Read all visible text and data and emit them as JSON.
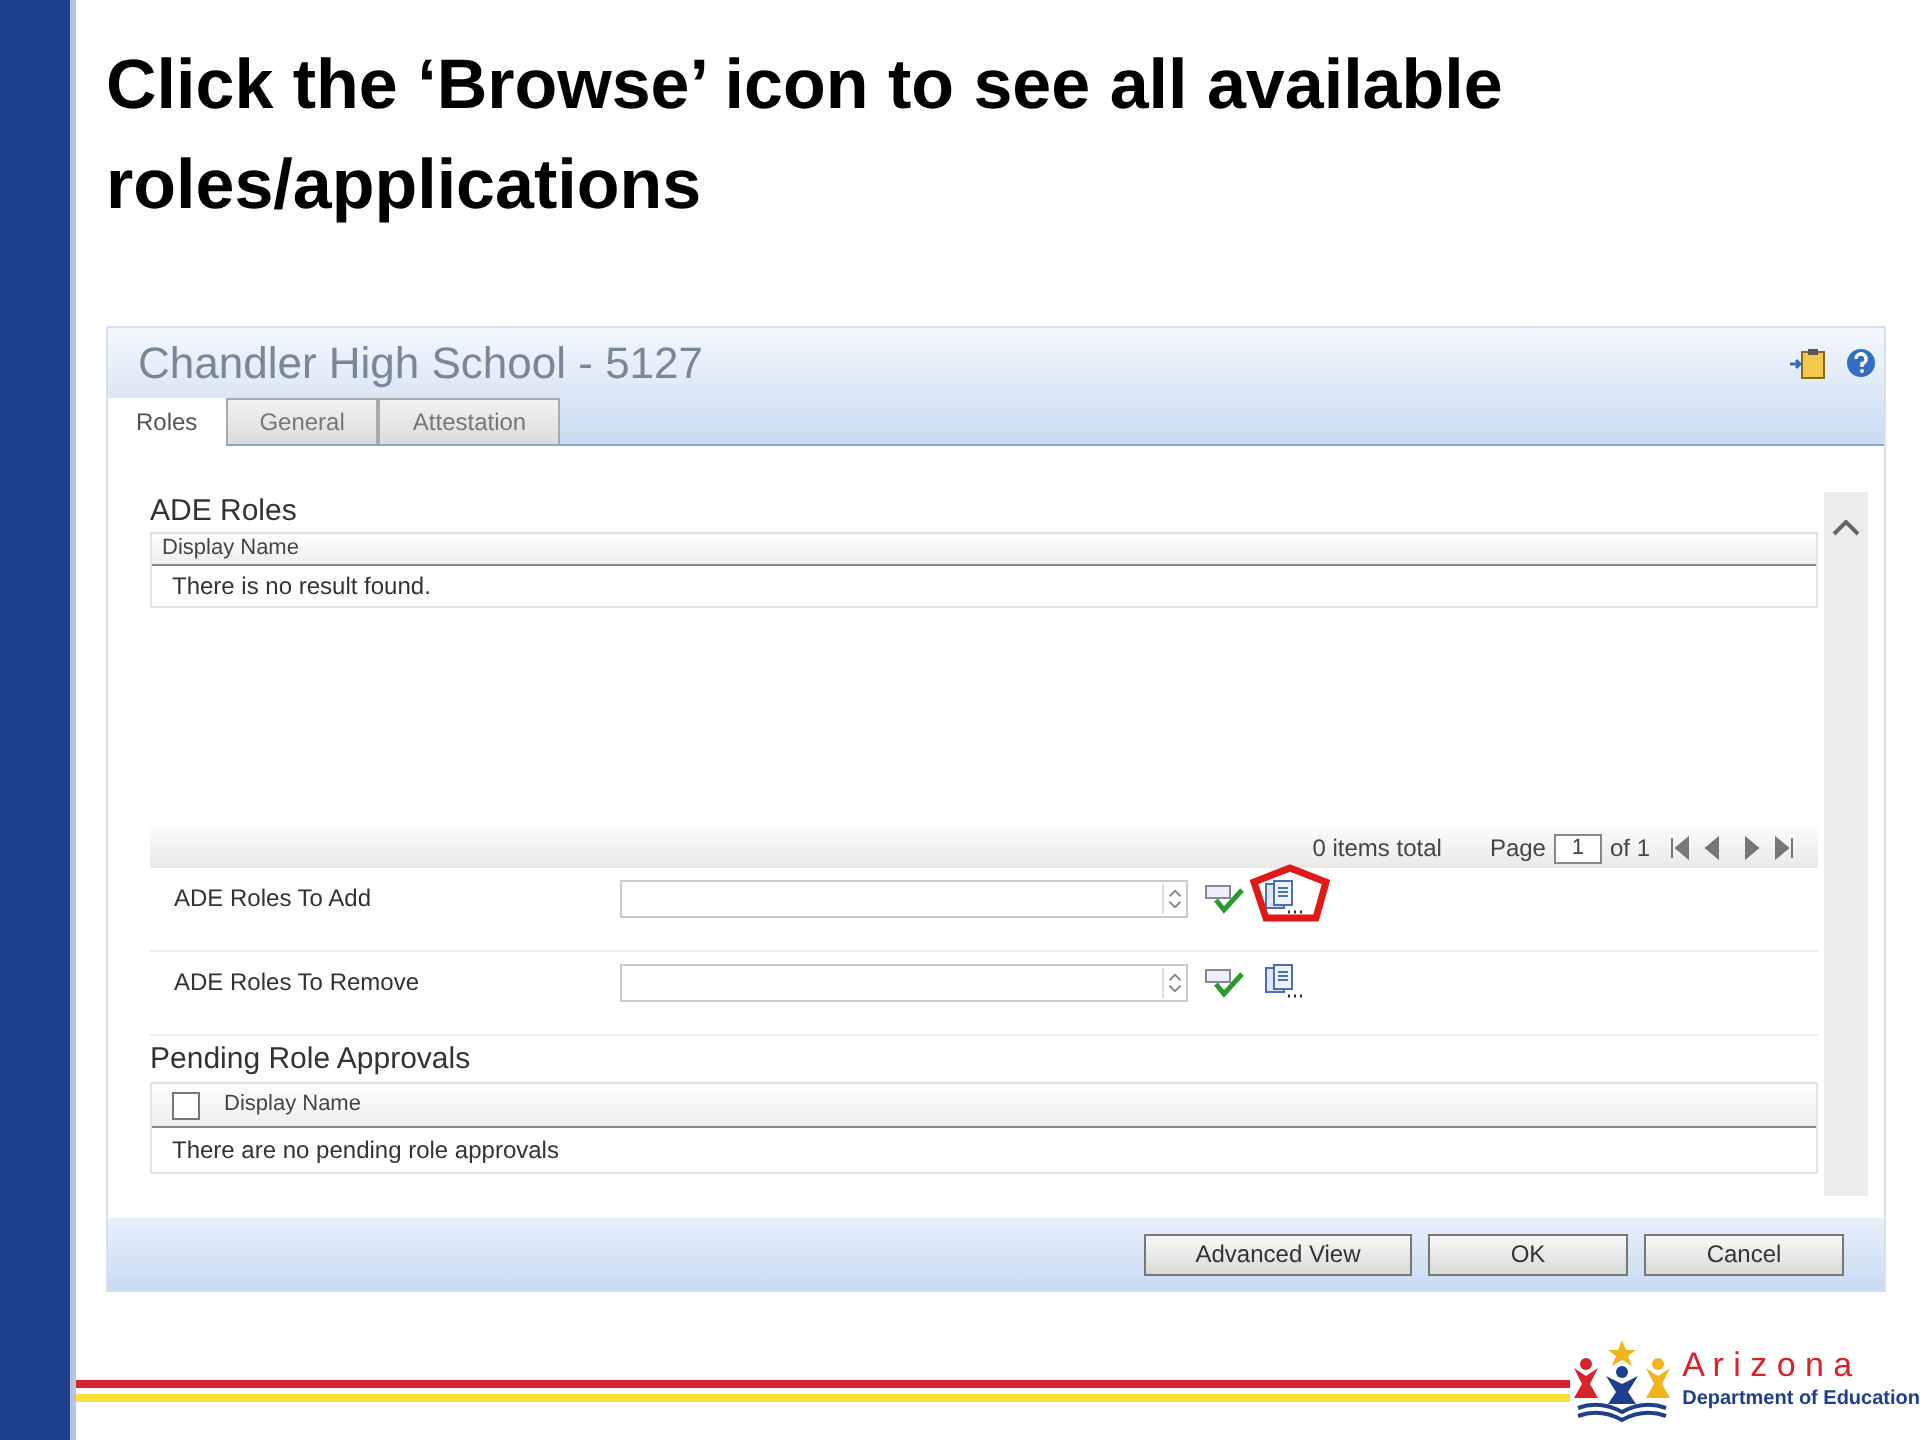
{
  "slide": {
    "title": "Click the ‘Browse’ icon to see all available roles/applications"
  },
  "panel": {
    "title": "Chandler High School - 5127",
    "tabs": [
      {
        "label": "Roles",
        "selected": true
      },
      {
        "label": "General",
        "selected": false
      },
      {
        "label": "Attestation",
        "selected": false
      }
    ],
    "ade_roles": {
      "heading": "ADE Roles",
      "column": "Display Name",
      "empty": "There is no result found.",
      "total": "0 items total",
      "page_label": "Page",
      "page": "1",
      "page_of": "of 1"
    },
    "fields": [
      {
        "label": "ADE Roles To Add",
        "highlighted": true
      },
      {
        "label": "ADE Roles To Remove",
        "highlighted": false
      }
    ],
    "pending": {
      "heading": "Pending Role Approvals",
      "column": "Display Name",
      "checked": false,
      "empty": "There are no pending role approvals"
    },
    "buttons": [
      "Advanced View",
      "OK",
      "Cancel"
    ]
  },
  "logo": {
    "name": "A r i z o n a",
    "subtitle": "Department of Education"
  }
}
